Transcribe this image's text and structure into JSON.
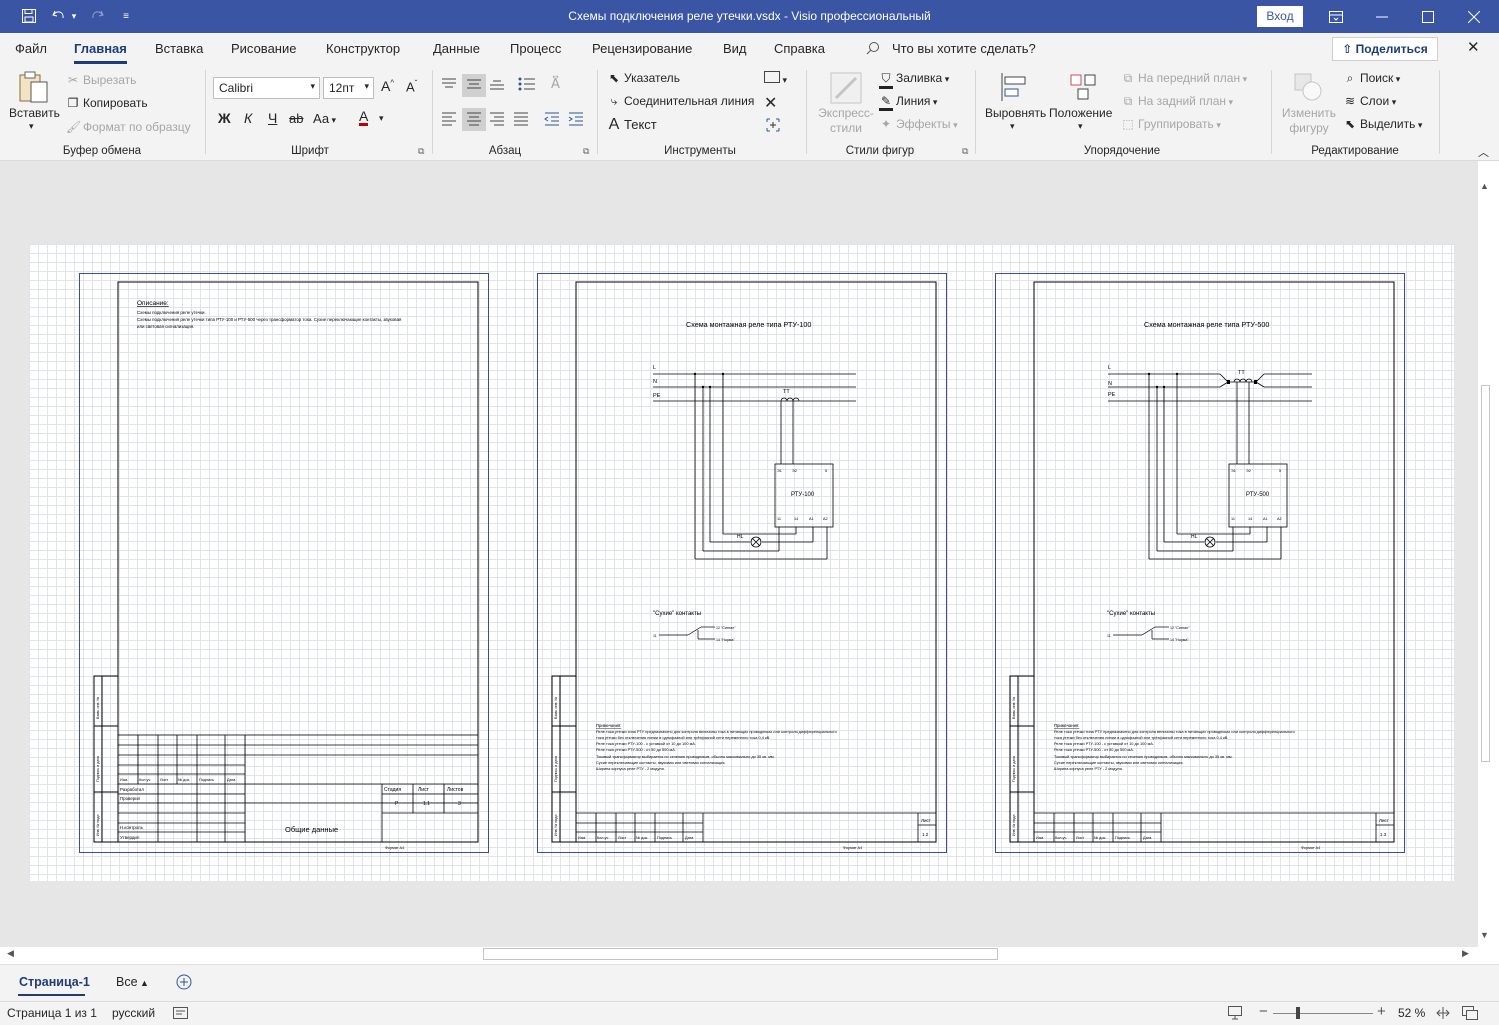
{
  "window": {
    "title": "Схемы подключения реле утечки.vsdx  -  Visio профессиональный",
    "signin_label": "Вход",
    "qa_icons": [
      "save-icon",
      "undo-icon",
      "redo-icon",
      "customize-icon"
    ]
  },
  "menu": {
    "tabs": [
      "Файл",
      "Главная",
      "Вставка",
      "Рисование",
      "Конструктор",
      "Данные",
      "Процесс",
      "Рецензирование",
      "Вид",
      "Справка"
    ],
    "active": "Главная",
    "search_placeholder": "Что вы хотите сделать?",
    "share_label": "Поделиться"
  },
  "ribbon": {
    "clipboard": {
      "paste": "Вставить",
      "cut": "Вырезать",
      "copy": "Копировать",
      "format_painter": "Формат по образцу",
      "label": "Буфер обмена"
    },
    "font": {
      "family": "Calibri",
      "size": "12пт",
      "bold": "Ж",
      "italic": "К",
      "underline": "Ч",
      "strike": "ab",
      "case": "Аа",
      "color_glyph": "A",
      "label": "Шрифт"
    },
    "paragraph": {
      "label": "Абзац"
    },
    "tools": {
      "pointer": "Указатель",
      "connector": "Соединительная линия",
      "text": "Текст",
      "label": "Инструменты"
    },
    "shape_styles": {
      "quick_styles": "Экспресс-стили",
      "fill": "Заливка",
      "line": "Линия",
      "effects": "Эффекты",
      "label": "Стили фигур"
    },
    "arrange": {
      "align": "Выровнять",
      "position": "Положение",
      "bring_front": "На передний план",
      "send_back": "На задний план",
      "group": "Группировать",
      "label": "Упорядочение"
    },
    "editing": {
      "change_shape": "Изменить фигуру",
      "find": "Поиск",
      "layers": "Слои",
      "select": "Выделить",
      "label": "Редактирование"
    }
  },
  "sheets": [
    {
      "description_title": "Описание:",
      "description_lines": [
        "Схемы подключения реле утечки.",
        "Схемы подключения реле утечки типа РТУ-100 и РТУ-500 через трансформатор тока. Сухие переключающие контакты, звуковая",
        "или световая сигнализация."
      ],
      "roles": [
        "Разработал",
        "Проверил",
        "",
        "Н.контроль",
        "Утвердил"
      ],
      "table_headers": [
        "Изм.",
        "Кол.уч",
        "Лист",
        "№ док.",
        "Подпись",
        "Дата"
      ],
      "stage_headers": [
        "Стадия",
        "Лист",
        "Листов"
      ],
      "stage_values": [
        "Р",
        "1.1",
        "3"
      ],
      "doc_name": "Общие данные",
      "format": "Формат А4",
      "side_labels": [
        "Инв. № подл.",
        "Подпись и дата",
        "Взам. инв. №"
      ]
    },
    {
      "title": "Схема монтажная реле типа РТУ-100",
      "lines": [
        "L",
        "N",
        "PE"
      ],
      "ct": "ТТ",
      "relay": "РТУ-100",
      "terminals_top": [
        "Э1",
        "Э2",
        "5"
      ],
      "terminals_bottom": [
        "11",
        "14",
        "A1",
        "A2"
      ],
      "lamp": "HL",
      "contacts_title": "\"Сухие\" контакты",
      "contact_labels": [
        "11",
        "12 \"Сигнал\"",
        "14 \"Норма\""
      ],
      "notes_title": "Примечания:",
      "notes": [
        "Реле тока утечки типа РТУ предназначено для контроля величины тока в питающих проводниках или контроля дифференциального",
        "тока утечки без отключения линии в однофазной или трёхфазной сети переменного тока 0,4 кВ.",
        "Реле тока утечки РТУ-100 - с уставкой от 10 до 100 мА.",
        "Реле тока утечки РТУ-500 - от 50 до 500 мА.",
        "Токовый трансформатор выбирается по сечению проводников, обычно максимально до 35 кв. мм.",
        "Сухие переключающие контакты, звуковая или световая сигнализация.",
        "Ширина корпуса реле РТУ - 2 модуля."
      ],
      "table_headers": [
        "Изм.",
        "Кол.уч",
        "Лист",
        "№ док.",
        "Подпись",
        "Дата"
      ],
      "sheet_label": "Лист",
      "sheet_no": "1.2",
      "format": "Формат А4",
      "side_labels": [
        "Инв. № подл.",
        "Подпись и дата",
        "Взам. инв. №"
      ]
    },
    {
      "title": "Схема монтажная реле типа РТУ-500",
      "lines": [
        "L",
        "N",
        "PE"
      ],
      "ct": "ТТ",
      "relay": "РТУ-500",
      "terminals_top": [
        "Э1",
        "Э2",
        "5"
      ],
      "terminals_bottom": [
        "11",
        "14",
        "A1",
        "A2"
      ],
      "lamp": "HL",
      "contacts_title": "\"Сухие\" контакты",
      "contact_labels": [
        "11",
        "12 \"Сигнал\"",
        "14 \"Норма\""
      ],
      "notes_title": "Примечания:",
      "notes": [
        "Реле тока утечки типа РТУ предназначено для контроля величины тока в питающих проводниках или контроля дифференциального",
        "тока утечки без отключения линии в однофазной или трёхфазной сети переменного тока 0,4 кВ.",
        "Реле тока утечки РТУ-100 - с уставкой от 10 до 100 мА.",
        "Реле тока утечки РТУ-500 - от 50 до 500 мА.",
        "Токовый трансформатор выбирается по сечению проводников, обычно максимально до 35 кв. мм.",
        "Сухие переключающие контакты, звуковая или световая сигнализация.",
        "Ширина корпуса реле РТУ - 2 модуля."
      ],
      "table_headers": [
        "Изм.",
        "Кол.уч",
        "Лист",
        "№ док.",
        "Подпись",
        "Дата"
      ],
      "sheet_label": "Лист",
      "sheet_no": "1.3",
      "format": "Формат А4",
      "side_labels": [
        "Инв. № подл.",
        "Подпись и дата",
        "Взам. инв. №"
      ]
    }
  ],
  "page_tabs": {
    "current": "Страница-1",
    "all_label": "Все"
  },
  "status": {
    "page": "Страница 1 из 1",
    "language": "русский",
    "zoom": "52 %"
  },
  "colors": {
    "title_bar": "#3955a3",
    "accent": "#1f3b7a",
    "sheet_border": "#3b4aa3"
  }
}
